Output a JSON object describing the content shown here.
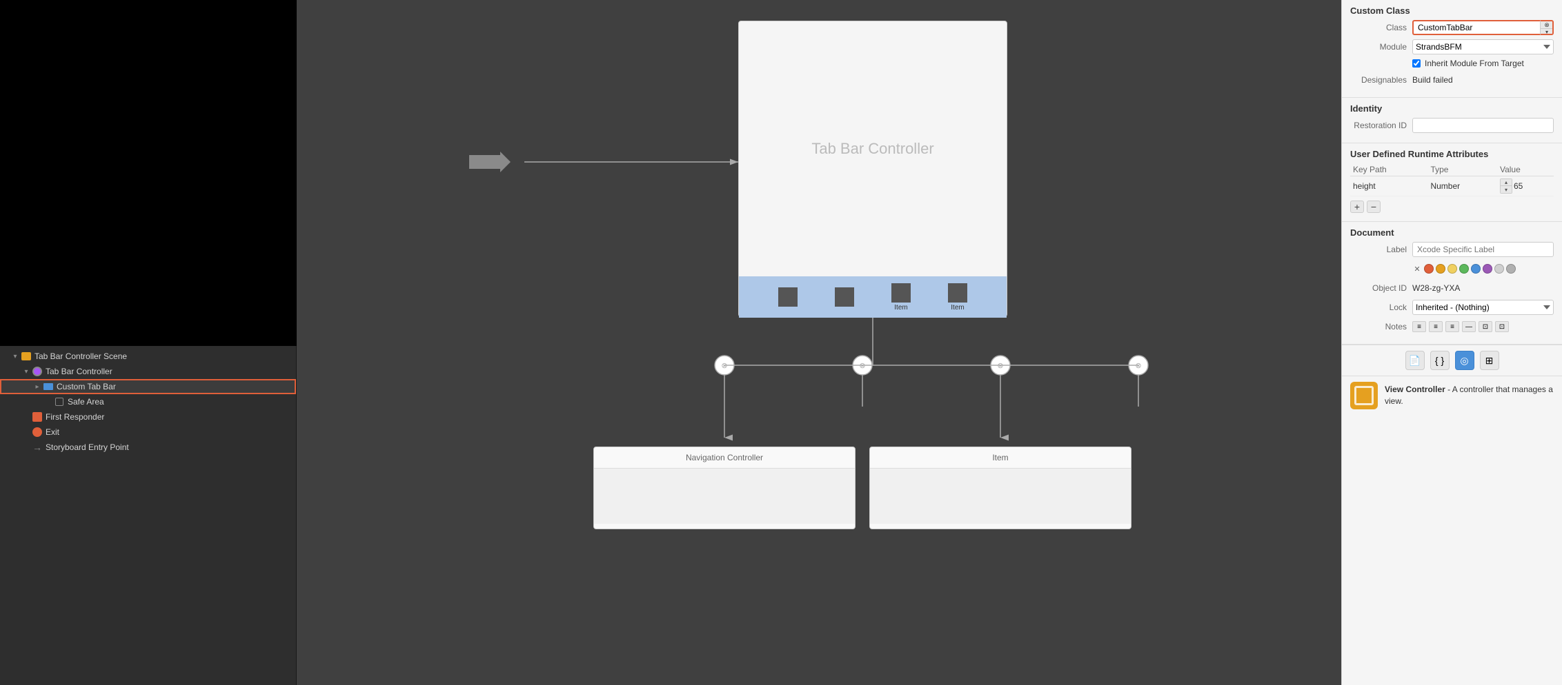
{
  "leftPanel": {
    "treeItems": [
      {
        "id": "scene",
        "label": "Tab Bar Controller Scene",
        "indent": 0,
        "type": "scene",
        "expandable": true,
        "expanded": true
      },
      {
        "id": "tabbar-controller",
        "label": "Tab Bar Controller",
        "indent": 1,
        "type": "controller",
        "expandable": true,
        "expanded": true
      },
      {
        "id": "custom-tab-bar",
        "label": "Custom Tab Bar",
        "indent": 2,
        "type": "customtab",
        "expandable": true,
        "expanded": false,
        "selected": true
      },
      {
        "id": "safe-area",
        "label": "Safe Area",
        "indent": 3,
        "type": "safearea",
        "expandable": false
      },
      {
        "id": "first-responder",
        "label": "First Responder",
        "indent": 1,
        "type": "firstresponder",
        "expandable": false
      },
      {
        "id": "exit",
        "label": "Exit",
        "indent": 1,
        "type": "exit",
        "expandable": false
      },
      {
        "id": "storyboard-entry",
        "label": "Storyboard Entry Point",
        "indent": 1,
        "type": "entry",
        "expandable": false
      }
    ]
  },
  "canvas": {
    "tabBarControllerLabel": "Tab Bar Controller",
    "navigationControllerLabel": "Navigation Controller",
    "itemLabel": "Item"
  },
  "rightPanel": {
    "customClass": {
      "sectionTitle": "Custom Class",
      "classLabel": "Class",
      "classValue": "CustomTabBar",
      "moduleLabel": "Module",
      "moduleValue": "StrandsBFM",
      "moduleDropdownValue": "StrandsBFM",
      "checkboxLabel": "Inherit Module From Target",
      "designablesLabel": "Designables",
      "designablesValue": "Build failed"
    },
    "identity": {
      "sectionTitle": "Identity",
      "restorationIdLabel": "Restoration ID",
      "restorationIdValue": ""
    },
    "userDefined": {
      "sectionTitle": "User Defined Runtime Attributes",
      "columns": [
        "Key Path",
        "Type",
        "Value"
      ],
      "rows": [
        {
          "keyPath": "height",
          "type": "Number",
          "value": "◇ 65"
        }
      ]
    },
    "document": {
      "sectionTitle": "Document",
      "labelLabel": "Label",
      "labelPlaceholder": "Xcode Specific Label",
      "objectIdLabel": "Object ID",
      "objectIdValue": "W28-zg-YXA",
      "lockLabel": "Lock",
      "lockValue": "Inherited - (Nothing)",
      "notesLabel": "Notes"
    },
    "vcInfo": {
      "title": "View Controller",
      "description": "- A controller that manages a view."
    },
    "colorDots": [
      "#e05f3a",
      "#e5a020",
      "#f0d060",
      "#5cb85c",
      "#4a90d9",
      "#9b59b6",
      "#d0d0d0",
      "#b0b0b0"
    ]
  }
}
